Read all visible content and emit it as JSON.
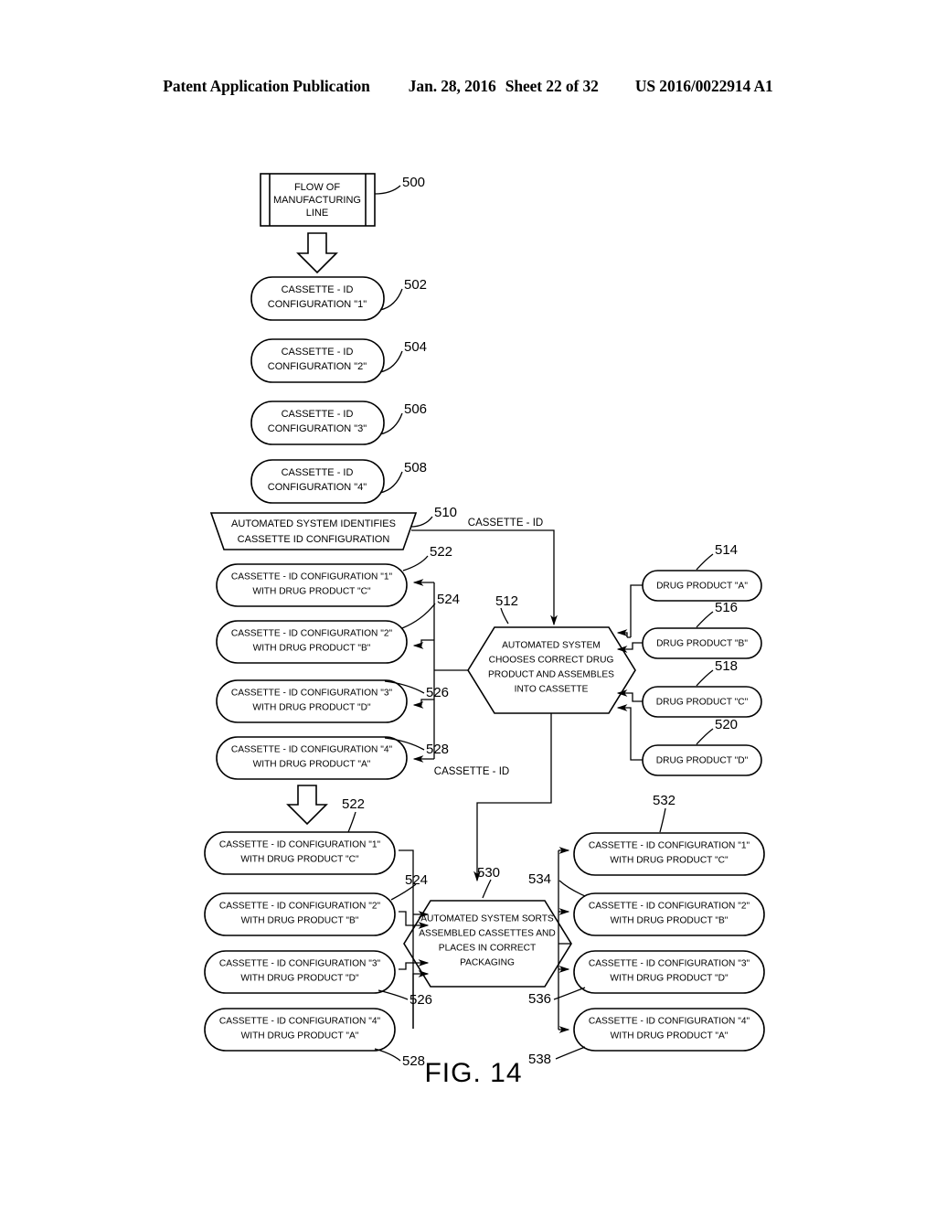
{
  "header": {
    "publication": "Patent Application Publication",
    "date": "Jan. 28, 2016",
    "sheet": "Sheet 22 of 32",
    "number": "US 2016/0022914 A1"
  },
  "figure": {
    "label": "FIG. 14"
  },
  "nodes": {
    "n500": {
      "ref": "500",
      "line1": "FLOW OF",
      "line2": "MANUFACTURING",
      "line3": "LINE"
    },
    "n502": {
      "ref": "502",
      "line1": "CASSETTE - ID",
      "line2": "CONFIGURATION \"1\""
    },
    "n504": {
      "ref": "504",
      "line1": "CASSETTE - ID",
      "line2": "CONFIGURATION \"2\""
    },
    "n506": {
      "ref": "506",
      "line1": "CASSETTE - ID",
      "line2": "CONFIGURATION \"3\""
    },
    "n508": {
      "ref": "508",
      "line1": "CASSETTE - ID",
      "line2": "CONFIGURATION \"4\""
    },
    "n510": {
      "ref": "510",
      "line1": "AUTOMATED SYSTEM IDENTIFIES",
      "line2": "CASSETTE ID CONFIGURATION"
    },
    "n512": {
      "ref": "512",
      "line1": "AUTOMATED SYSTEM",
      "line2": "CHOOSES CORRECT DRUG",
      "line3": "PRODUCT AND ASSEMBLES",
      "line4": "INTO CASSETTE"
    },
    "n514": {
      "ref": "514",
      "line1": "DRUG PRODUCT \"A\""
    },
    "n516": {
      "ref": "516",
      "line1": "DRUG PRODUCT \"B\""
    },
    "n518": {
      "ref": "518",
      "line1": "DRUG PRODUCT \"C\""
    },
    "n520": {
      "ref": "520",
      "line1": "DRUG PRODUCT \"D\""
    },
    "n522": {
      "ref": "522",
      "line1": "CASSETTE - ID CONFIGURATION \"1\"",
      "line2": "WITH DRUG PRODUCT \"C\""
    },
    "n524": {
      "ref": "524",
      "line1": "CASSETTE - ID CONFIGURATION \"2\"",
      "line2": "WITH DRUG PRODUCT \"B\""
    },
    "n526": {
      "ref": "526",
      "line1": "CASSETTE - ID CONFIGURATION \"3\"",
      "line2": "WITH DRUG PRODUCT \"D\""
    },
    "n528": {
      "ref": "528",
      "line1": "CASSETTE - ID CONFIGURATION \"4\"",
      "line2": "WITH DRUG PRODUCT \"A\""
    },
    "n522b": {
      "ref": "522",
      "line1": "CASSETTE - ID CONFIGURATION \"1\"",
      "line2": "WITH DRUG PRODUCT \"C\""
    },
    "n524b": {
      "ref": "524",
      "line1": "CASSETTE - ID CONFIGURATION \"2\"",
      "line2": "WITH DRUG PRODUCT \"B\""
    },
    "n526b": {
      "ref": "526",
      "line1": "CASSETTE - ID CONFIGURATION \"3\"",
      "line2": "WITH DRUG PRODUCT \"D\""
    },
    "n528b": {
      "ref": "528",
      "line1": "CASSETTE - ID CONFIGURATION \"4\"",
      "line2": "WITH DRUG PRODUCT \"A\""
    },
    "n530": {
      "ref": "530",
      "line1": "AUTOMATED SYSTEM SORTS",
      "line2": "ASSEMBLED CASSETTES AND",
      "line3": "PLACES IN CORRECT",
      "line4": "PACKAGING"
    },
    "n532": {
      "ref": "532",
      "line1": "CASSETTE - ID CONFIGURATION \"1\"",
      "line2": "WITH DRUG PRODUCT \"C\""
    },
    "n534": {
      "ref": "534",
      "line1": "CASSETTE - ID CONFIGURATION \"2\"",
      "line2": "WITH DRUG PRODUCT \"B\""
    },
    "n536": {
      "ref": "536",
      "line1": "CASSETTE - ID CONFIGURATION \"3\"",
      "line2": "WITH DRUG PRODUCT \"D\""
    },
    "n538": {
      "ref": "538",
      "line1": "CASSETTE - ID CONFIGURATION \"4\"",
      "line2": "WITH DRUG PRODUCT \"A\""
    }
  },
  "edges": {
    "cassette_id_top": "CASSETTE - ID",
    "cassette_id_bottom": "CASSETTE - ID"
  }
}
